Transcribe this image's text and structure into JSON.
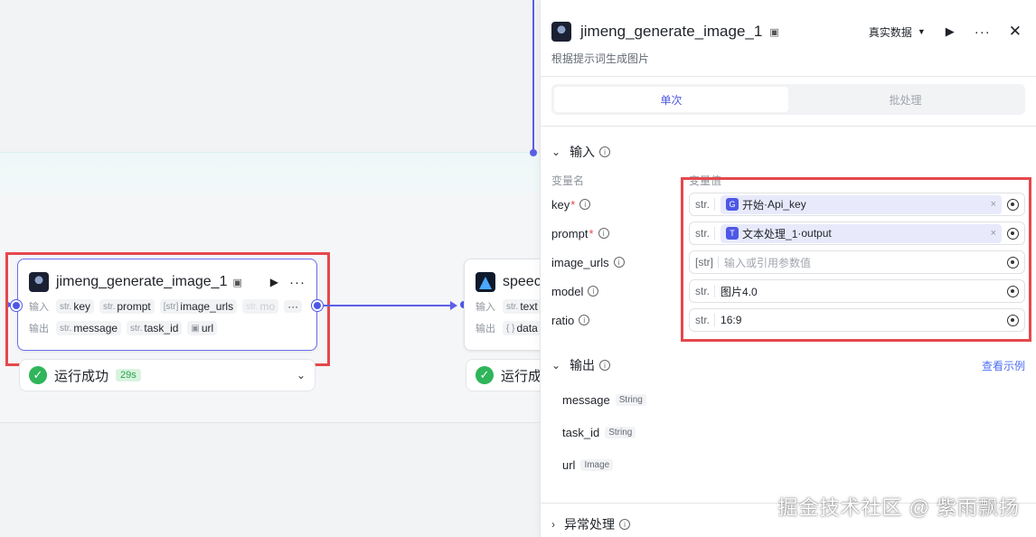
{
  "canvas": {
    "main_node": {
      "title": "jimeng_generate_image_1",
      "badge_icon": "sticker-icon",
      "inputs_label": "输入",
      "outputs_label": "输出",
      "inputs": [
        {
          "type": "str.",
          "name": "key"
        },
        {
          "type": "str.",
          "name": "prompt"
        },
        {
          "type": "[str]",
          "name": "image_urls"
        },
        {
          "type": "str.",
          "name": "mo"
        }
      ],
      "outputs": [
        {
          "type": "str.",
          "name": "message"
        },
        {
          "type": "str.",
          "name": "task_id"
        },
        {
          "type": "img",
          "name": "url"
        }
      ],
      "more": "···",
      "status": "运行成功",
      "time": "29s"
    },
    "second_node": {
      "title": "speec",
      "inputs_label": "输入",
      "outputs_label": "输出",
      "input": {
        "type": "str.",
        "name": "text"
      },
      "output": {
        "type": "{ }",
        "name": "data"
      },
      "status": "运行成"
    }
  },
  "panel": {
    "title": "jimeng_generate_image_1",
    "mode": "真实数据",
    "description": "根据提示词生成图片",
    "tabs": [
      {
        "label": "单次",
        "active": true
      },
      {
        "label": "批处理",
        "active": false
      }
    ],
    "input_section": {
      "title": "输入",
      "col_name": "变量名",
      "col_value": "变量值",
      "rows": [
        {
          "name": "key",
          "required": "*",
          "type": "str.",
          "kind": "ref",
          "ref_source": "开始",
          "ref_field": "Api_key",
          "ref_sep": " · "
        },
        {
          "name": "prompt",
          "required": "*",
          "type": "str.",
          "kind": "ref",
          "ref_source": "文本处理_1",
          "ref_field": "output",
          "ref_sep": " · "
        },
        {
          "name": "image_urls",
          "required": "",
          "type": "[str]",
          "kind": "placeholder",
          "value": "输入或引用参数值"
        },
        {
          "name": "model",
          "required": "",
          "type": "str.",
          "kind": "value",
          "value": "图片4.0"
        },
        {
          "name": "ratio",
          "required": "",
          "type": "str.",
          "kind": "value",
          "value": "16:9"
        }
      ]
    },
    "output_section": {
      "title": "输出",
      "link": "查看示例",
      "rows": [
        {
          "name": "message",
          "type": "String"
        },
        {
          "name": "task_id",
          "type": "String"
        },
        {
          "name": "url",
          "type": "Image"
        }
      ]
    },
    "error_section": {
      "title": "异常处理"
    }
  },
  "watermark": "掘金技术社区 @ 紫雨飘扬",
  "colors": {
    "accent": "#4e58e6",
    "highlight": "#e5484d",
    "success": "#2fb55a"
  }
}
